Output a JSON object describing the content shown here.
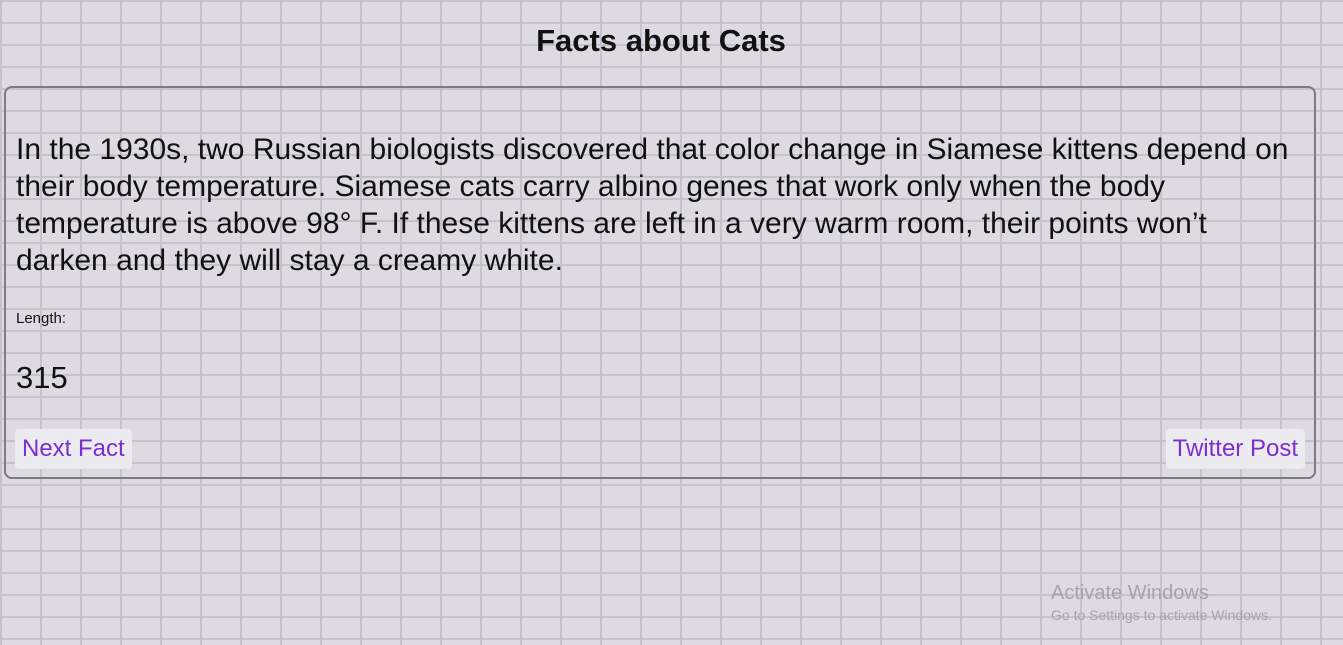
{
  "page": {
    "title": "Facts about Cats"
  },
  "fact": {
    "text": "In the 1930s, two Russian biologists discovered that color change in Siamese kittens depend on their body temperature. Siamese cats carry albino genes that work only when the body temperature is above 98° F. If these kittens are left in a very warm room, their points won’t darken and they will stay a creamy white.",
    "length_label": "Length:",
    "length_value": "315"
  },
  "buttons": {
    "next_label": "Next Fact",
    "twitter_label": "Twitter Post"
  },
  "watermark": {
    "title": "Activate Windows",
    "subtitle": "Go to Settings to activate Windows."
  },
  "colors": {
    "background": "#dddae3",
    "brick_lines": "#c6c2cd",
    "button_text": "#7b2fd1",
    "button_bg": "#ecebef",
    "card_border": "#7d7a82"
  }
}
